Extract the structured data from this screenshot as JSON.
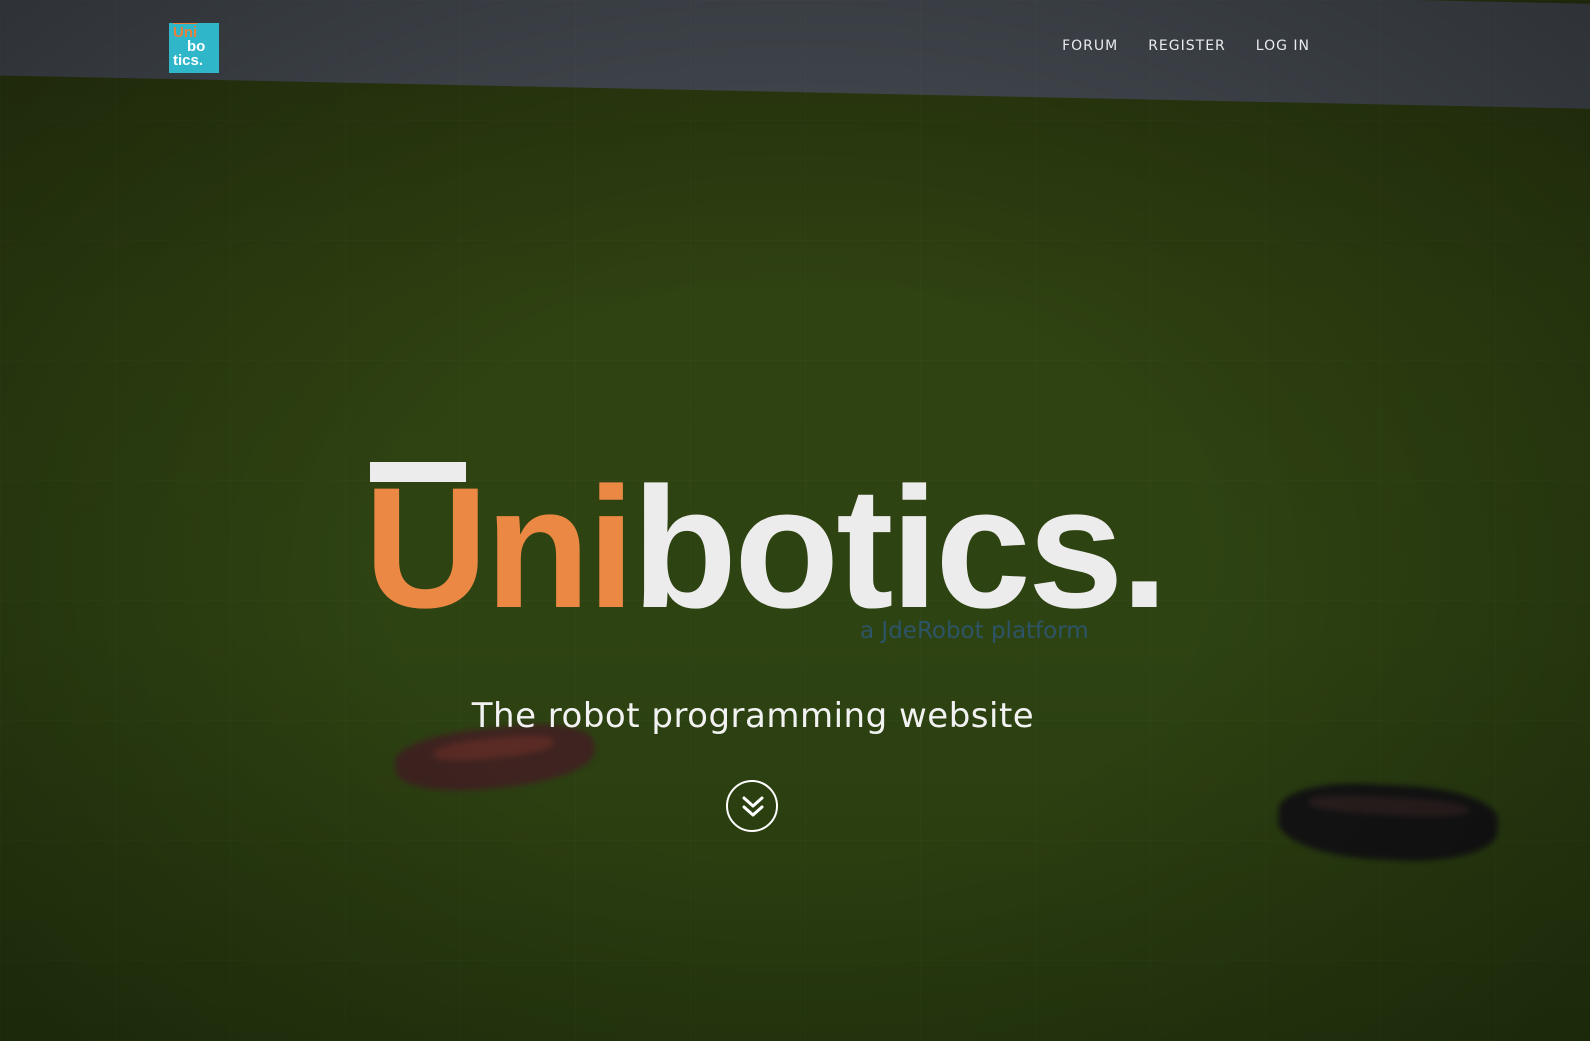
{
  "header": {
    "logo": {
      "line1": "Uni",
      "line2": "bo",
      "line3": "tics."
    },
    "nav": [
      {
        "label": "FORUM"
      },
      {
        "label": "REGISTER"
      },
      {
        "label": "LOG IN"
      }
    ]
  },
  "hero": {
    "brand_accent": "Uni",
    "brand_rest": "botics.",
    "tagline": "a JdeRobot platform",
    "subtitle": "The robot programming website"
  },
  "colors": {
    "accent": "#ea8844",
    "logo_bg": "#2fb7c9",
    "tagline": "#2d5467"
  },
  "icons": {
    "scroll": "chevron-double-down-icon"
  }
}
